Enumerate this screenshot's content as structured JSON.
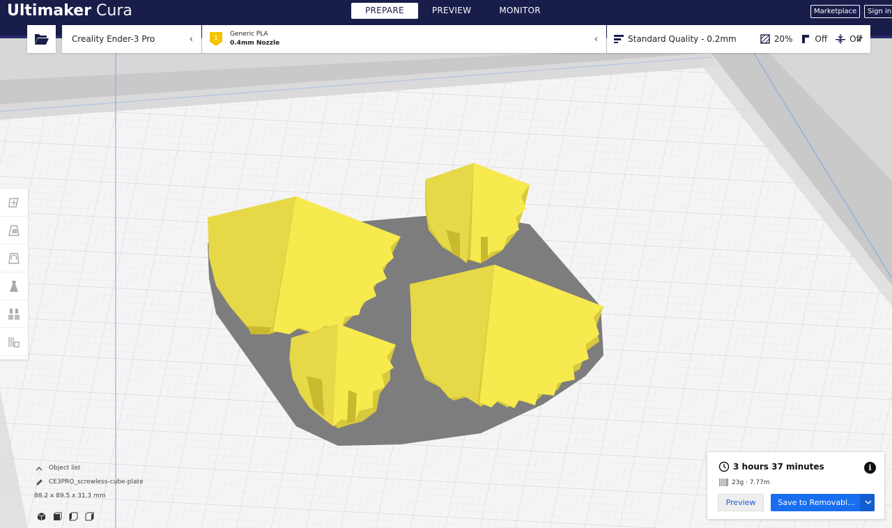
{
  "app": {
    "brand_bold": "Ultimaker",
    "brand_light": "Cura"
  },
  "stages": [
    {
      "label": "PREPARE",
      "active": true
    },
    {
      "label": "PREVIEW",
      "active": false
    },
    {
      "label": "MONITOR",
      "active": false
    }
  ],
  "header_buttons": {
    "marketplace": "Marketplace",
    "signin": "Sign in"
  },
  "toolbar": {
    "open_icon": "folder-open-icon",
    "printer": "Creality Ender-3 Pro",
    "material_badge": "1",
    "material_name": "Generic PLA",
    "nozzle": "0.4mm Nozzle",
    "quality": "Standard Quality - 0.2mm",
    "infill": "20%",
    "support": "Off",
    "adhesion": "Off"
  },
  "tools": [
    {
      "icon": "move-tool-icon"
    },
    {
      "icon": "scale-tool-icon"
    },
    {
      "icon": "rotate-tool-icon"
    },
    {
      "icon": "mirror-tool-icon"
    },
    {
      "icon": "per-model-settings-icon"
    },
    {
      "icon": "support-blocker-icon"
    }
  ],
  "object_list": {
    "toggle_label": "Object list",
    "file_name": "CE3PRO_screwless-cube-plate",
    "dimensions": "88.2 x 89.5 x 31.3 mm"
  },
  "view_icons": [
    "3d-view-icon",
    "front-view-icon",
    "left-view-icon",
    "right-view-icon"
  ],
  "print_panel": {
    "time": "3 hours 37 minutes",
    "material_usage": "23g · 7.77m",
    "preview_label": "Preview",
    "save_label": "Save to Removabl..."
  },
  "colors": {
    "header": "#191d4a",
    "accent": "#196ef0",
    "model_yellow": "#f5e642",
    "shadow": "#7a7a7a"
  }
}
